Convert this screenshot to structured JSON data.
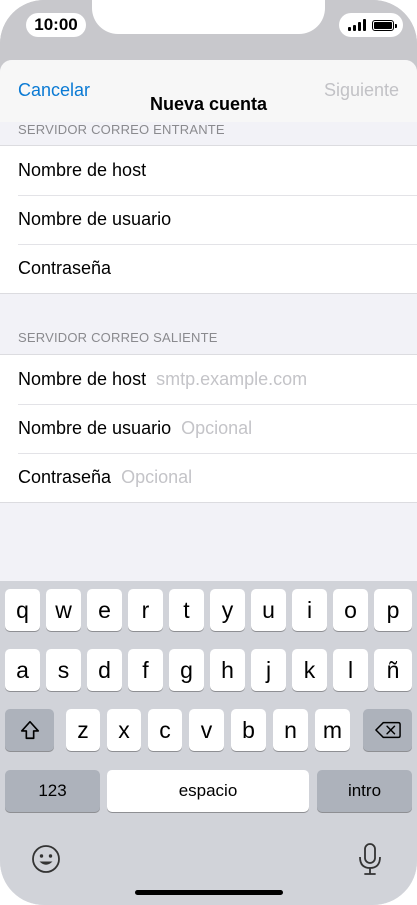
{
  "status_bar": {
    "time": "10:00"
  },
  "nav": {
    "cancel_label": "Cancelar",
    "title": "Nueva cuenta",
    "next_label": "Siguiente"
  },
  "incoming": {
    "header": "SERVIDOR CORREO ENTRANTE",
    "rows": [
      {
        "label": "Nombre de host",
        "placeholder": ""
      },
      {
        "label": "Nombre de usuario",
        "placeholder": ""
      },
      {
        "label": "Contraseña",
        "placeholder": ""
      }
    ]
  },
  "outgoing": {
    "header": "SERVIDOR CORREO SALIENTE",
    "rows": [
      {
        "label": "Nombre de host",
        "placeholder": "smtp.example.com"
      },
      {
        "label": "Nombre de usuario",
        "placeholder": "Opcional"
      },
      {
        "label": "Contraseña",
        "placeholder": "Opcional"
      }
    ]
  },
  "keyboard": {
    "row1": [
      "q",
      "w",
      "e",
      "r",
      "t",
      "y",
      "u",
      "i",
      "o",
      "p"
    ],
    "row2": [
      "a",
      "s",
      "d",
      "f",
      "g",
      "h",
      "j",
      "k",
      "l",
      "ñ"
    ],
    "row3": [
      "z",
      "x",
      "c",
      "v",
      "b",
      "n",
      "m"
    ],
    "numbers_label": "123",
    "space_label": "espacio",
    "return_label": "intro",
    "icons": {
      "shift": "shift-icon",
      "delete": "delete-icon",
      "emoji": "emoji-icon",
      "mic": "microphone-icon"
    }
  }
}
